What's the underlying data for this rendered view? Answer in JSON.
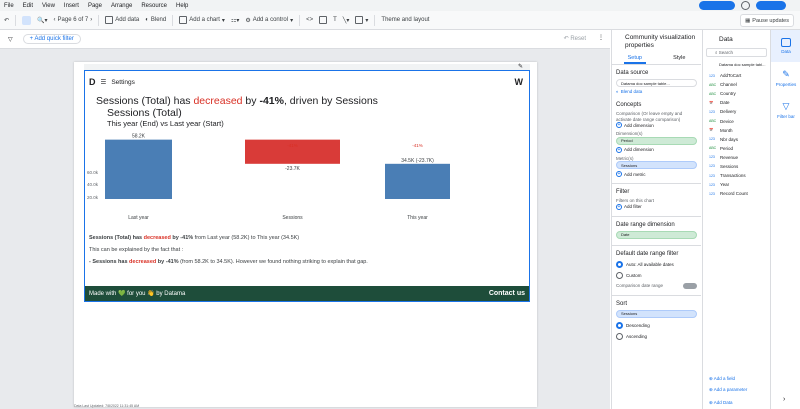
{
  "menu": [
    "File",
    "Edit",
    "View",
    "Insert",
    "Page",
    "Arrange",
    "Resource",
    "Help"
  ],
  "toolbar": {
    "page_label": "Page 6 of 7",
    "add_data": "Add data",
    "blend": "Blend",
    "add_chart": "Add a chart",
    "add_control": "Add a control",
    "theme": "Theme and layout",
    "pause": "Pause updates"
  },
  "filterbar": {
    "quick_filter": "+ Add quick filter",
    "reset": "Reset"
  },
  "report": {
    "settings": "Settings",
    "title_pre": "Sessions (Total) has ",
    "title_red": "decreased",
    "title_mid": " by ",
    "title_pct": "-41%",
    "title_post": ", driven by Sessions",
    "title_line2": "Sessions (Total)",
    "subtitle": "This year (End) vs Last year (Start)",
    "summary1_pre": "Sessions (Total) has ",
    "summary1_red": "decreased",
    "summary1_mid": " by -41%",
    "summary1_post": " from Last year (58.2K) to This year (34.5K)",
    "summary2": "This can be explained by the fact that :",
    "summary3_pre": "- Sessions has ",
    "summary3_red": "decreased",
    "summary3_mid": " by -41%",
    "summary3_post": " (from 58.2K to 34.5K). However we found nothing striking to explain that gap.",
    "footer_left": "Made with 💚 for you 👋 by Datama",
    "footer_right": "Contact us",
    "last_updated": "Data Last Updated: 7/8/2022 11:31:45 AM"
  },
  "chart_data": {
    "type": "bar",
    "categories": [
      "Last year",
      "Sessions",
      "This year"
    ],
    "values": [
      58.2,
      -23.7,
      34.5
    ],
    "data_labels": [
      "58.2K",
      "-23.7K",
      "34.5K (-23.7K)"
    ],
    "top_labels": [
      "",
      "-41%",
      "-41%"
    ],
    "y_ticks": [
      "60.0k",
      "40.0k",
      "20.0k"
    ],
    "colors": [
      "#4a7eb5",
      "#d93b38",
      "#4a7eb5"
    ]
  },
  "props": {
    "title_line1": "Community visualization",
    "title_line2": "properties",
    "tab_setup": "Setup",
    "tab_style": "Style",
    "data_source_hd": "Data source",
    "data_source": "Datama doc sample table...",
    "blend": "Blend data",
    "concepts_hd": "Concepts",
    "comparison": "Comparison (Or leave empty and activate date range comparison)",
    "add_dimension": "Add dimension",
    "dimensions_hd": "Dimension(s)",
    "dimension_chip": "Period",
    "metrics_hd": "Metric(s)",
    "metric_chip": "Sessions",
    "add_metric": "Add metric",
    "filter_hd": "Filter",
    "filter_sub": "Filters on this chart",
    "add_filter": "Add filter",
    "date_dim_hd": "Date range dimension",
    "date_chip": "Date",
    "default_date_hd": "Default date range filter",
    "auto": "Auto: All available dates",
    "custom": "Custom",
    "comparison_date": "Comparison date range",
    "sort_hd": "Sort",
    "sort_chip": "Sessions",
    "desc": "Descending",
    "asc": "Ascending"
  },
  "datapanel": {
    "title": "Data",
    "search": "Search",
    "source": "Datama doc sample tabl...",
    "fields": [
      {
        "t": "123",
        "n": "AddToCart"
      },
      {
        "t": "ABC",
        "n": "Channel"
      },
      {
        "t": "ABC",
        "n": "Country"
      },
      {
        "t": "📅",
        "n": "Date"
      },
      {
        "t": "123",
        "n": "Delivery"
      },
      {
        "t": "ABC",
        "n": "Device"
      },
      {
        "t": "📅",
        "n": "Month"
      },
      {
        "t": "123",
        "n": "Nbr days"
      },
      {
        "t": "ABC",
        "n": "Period"
      },
      {
        "t": "123",
        "n": "Revenue"
      },
      {
        "t": "123",
        "n": "Sessions"
      },
      {
        "t": "123",
        "n": "Transactions"
      },
      {
        "t": "123",
        "n": "Year"
      },
      {
        "t": "123",
        "n": "Record Count"
      }
    ],
    "add_field": "Add a field",
    "add_param": "Add a parameter",
    "add_data": "Add Data"
  },
  "rail": [
    "Data",
    "Properties",
    "Filter bar"
  ]
}
